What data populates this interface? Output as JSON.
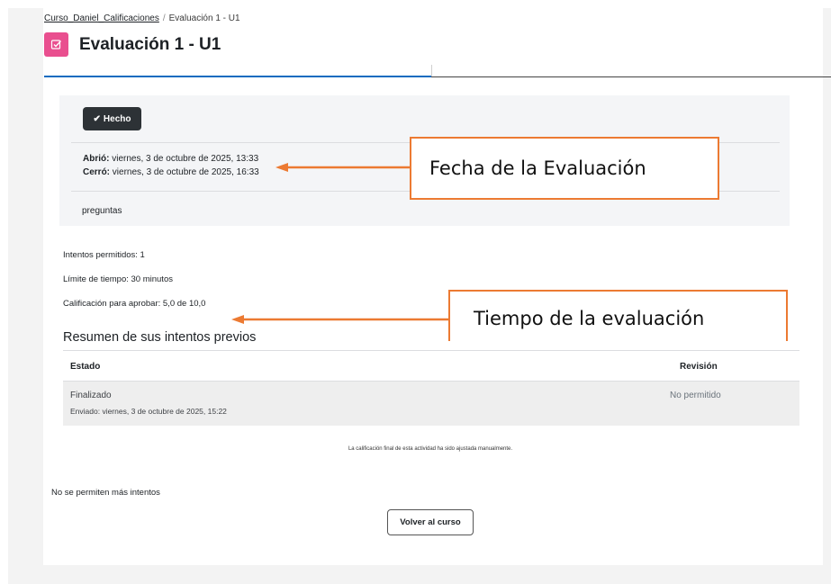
{
  "breadcrumb": {
    "course": "Curso_Daniel_Calificaciones",
    "separator": "/",
    "current": "Evaluación 1 - U1"
  },
  "page": {
    "title": "Evaluación 1 - U1",
    "icon": "quiz-icon"
  },
  "info": {
    "done_label": "Hecho",
    "opened_label": "Abrió:",
    "opened_value": "viernes, 3 de octubre de 2025, 13:33",
    "closed_label": "Cerró:",
    "closed_value": "viernes, 3 de octubre de 2025, 16:33",
    "description": "preguntas"
  },
  "details": {
    "attempts_allowed": "Intentos permitidos: 1",
    "time_limit": "Límite de tiempo: 30 minutos",
    "passing_grade": "Calificación para aprobar: 5,0 de 10,0"
  },
  "summary": {
    "title": "Resumen de sus intentos previos",
    "columns": [
      "Estado",
      "Revisión"
    ],
    "rows": [
      {
        "state": "Finalizado",
        "submitted": "Enviado: viernes, 3 de octubre de 2025, 15:22",
        "review": "No permitido"
      }
    ]
  },
  "note": "La calificación final de esta actividad ha sido ajustada manualmente.",
  "no_more_attempts": "No se permiten más intentos",
  "back_button": "Volver al curso",
  "annotations": {
    "date_callout": "Fecha de la Evaluación",
    "time_callout": "Tiempo de la evaluación",
    "color": "#ec7a32"
  },
  "colors": {
    "quiz_icon": "#e94f8f",
    "tab_active": "#0f6cbf",
    "done_button": "#2d3236"
  }
}
